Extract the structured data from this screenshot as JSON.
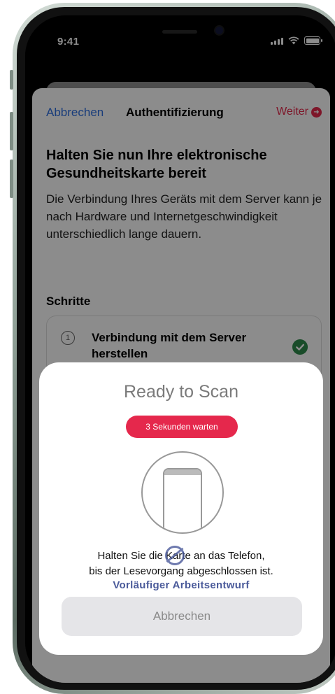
{
  "status_bar": {
    "time": "9:41"
  },
  "nav": {
    "cancel_label": "Abbrechen",
    "title": "Authentifizierung",
    "next_label": "Weiter"
  },
  "content": {
    "title": "Halten Sie nun Ihre elektronische Gesundheitskarte bereit",
    "description": "Die Verbindung Ihres Geräts mit dem Server kann je nach Hardware und Internetgeschwindigkeit unterschiedlich lange dauern.",
    "steps_header": "Schritte",
    "steps": [
      {
        "number": "1",
        "label": "Verbindung mit dem Server herstellen",
        "completed": true
      }
    ]
  },
  "scan_sheet": {
    "title": "Ready to Scan",
    "wait_badge": "3 Sekunden warten",
    "instruction_line1": "Halten Sie die Karte an das Telefon,",
    "instruction_line2": "bis der Lesevorgang abgeschlossen ist.",
    "watermark": "Vorläufiger Arbeitsentwurf",
    "cancel_label": "Abbrechen"
  },
  "colors": {
    "accent_red": "#e5284c",
    "link_blue": "#2f6fe0",
    "success_green": "#2f8a4c",
    "draft_blue": "#4a5a9a"
  },
  "icons": [
    "signal-icon",
    "wifi-icon",
    "battery-icon",
    "arrow-right-circle-icon",
    "checkmark-icon",
    "phone-icon",
    "draft-stamp-icon"
  ]
}
